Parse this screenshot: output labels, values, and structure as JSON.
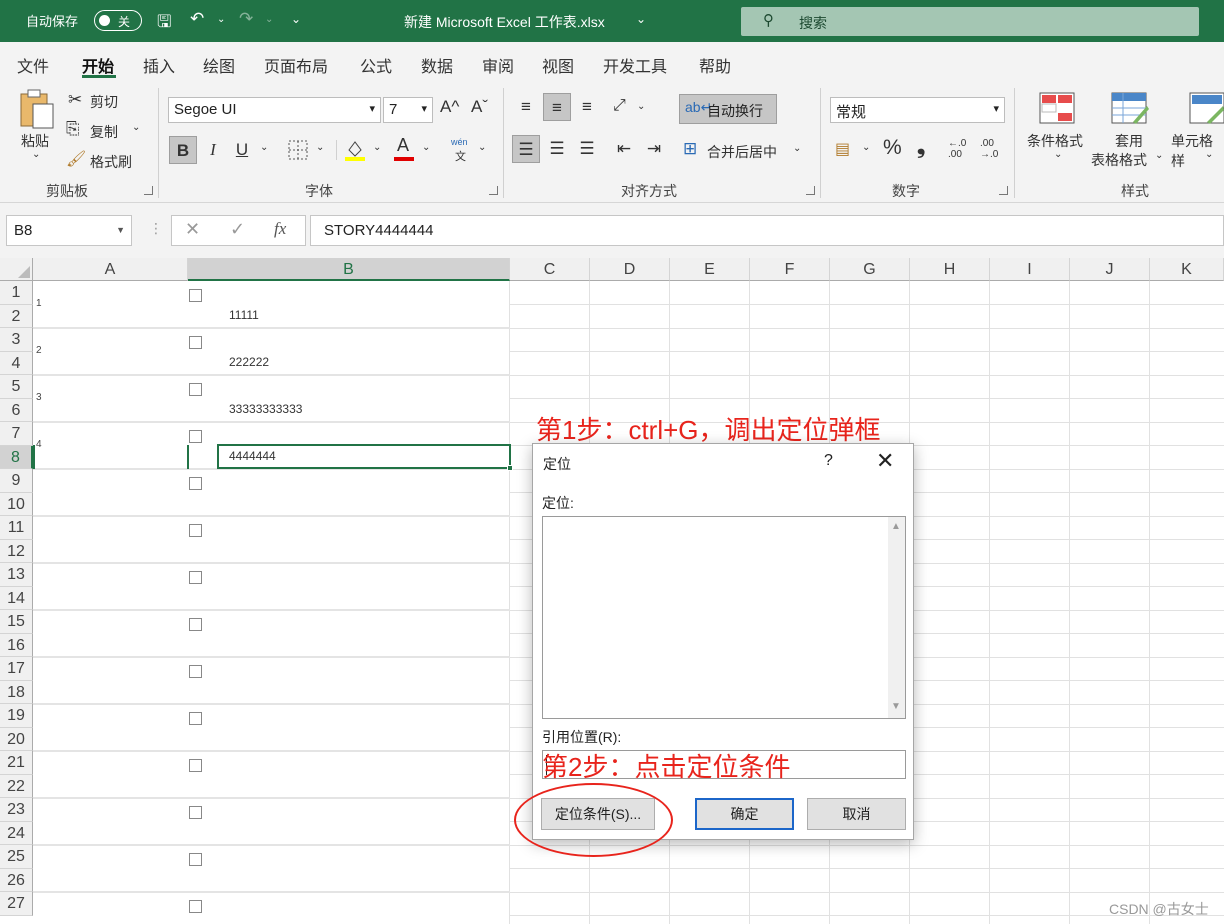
{
  "titlebar": {
    "autosave_label": "自动保存",
    "autosave_state": "关",
    "doc_title": "新建 Microsoft Excel 工作表.xlsx",
    "search_placeholder": "搜索",
    "colors": {
      "accent": "#217346",
      "search_bg": "#a4c6b3"
    }
  },
  "tabs": [
    "文件",
    "开始",
    "插入",
    "绘图",
    "页面布局",
    "公式",
    "数据",
    "审阅",
    "视图",
    "开发工具",
    "帮助"
  ],
  "active_tab": "开始",
  "ribbon": {
    "clipboard": {
      "label": "剪贴板",
      "paste": "粘贴",
      "cut": "剪切",
      "copy": "复制",
      "format_painter": "格式刷"
    },
    "font": {
      "label": "字体",
      "font_name": "Segoe UI",
      "font_size": "7",
      "bold": "B",
      "italic": "I",
      "underline": "U",
      "font_color_glyph": "A",
      "phonetic": "wén",
      "phonetic_sub": "文",
      "grow": "A^",
      "shrink": "Aˇ"
    },
    "alignment": {
      "label": "对齐方式",
      "wrap_text": "自动换行",
      "merge_center": "合并后居中"
    },
    "number": {
      "label": "数字",
      "format": "常规",
      "percent": "%",
      "comma": "❟",
      "inc_decimal": "←.0 .00",
      "dec_decimal": ".00 →.0"
    },
    "styles": {
      "label": "样式",
      "conditional": "条件格式",
      "table_format_1": "套用",
      "table_format_2": "表格格式",
      "cell_styles": "单元格样"
    }
  },
  "formula_bar": {
    "name_box": "B8",
    "cancel": "✕",
    "enter": "✓",
    "fx": "fx",
    "formula": "STORY4444444"
  },
  "columns": [
    "A",
    "B",
    "C",
    "D",
    "E",
    "F",
    "G",
    "H",
    "I",
    "J",
    "K"
  ],
  "rows": [
    "1",
    "2",
    "3",
    "4",
    "5",
    "6",
    "7",
    "8",
    "9",
    "10",
    "11",
    "12",
    "13",
    "14",
    "15",
    "16",
    "17",
    "18",
    "19",
    "20",
    "21",
    "22",
    "23",
    "24",
    "25",
    "26",
    "27"
  ],
  "cells": {
    "a_index": [
      "1",
      "2",
      "3",
      "4"
    ],
    "b_values": [
      "11111",
      "222222",
      "33333333333",
      "4444444"
    ]
  },
  "dialog": {
    "title": "定位",
    "help": "?",
    "close": "✕",
    "goto_label": "定位:",
    "reference_label": "引用位置(R):",
    "special_button": "定位条件(S)...",
    "ok_button": "确定",
    "cancel_button": "取消"
  },
  "annotations": {
    "step1": "第1步：ctrl+G，调出定位弹框",
    "step2": "第2步：点击定位条件",
    "color": "#e8241c"
  },
  "watermark": "CSDN @古女士"
}
